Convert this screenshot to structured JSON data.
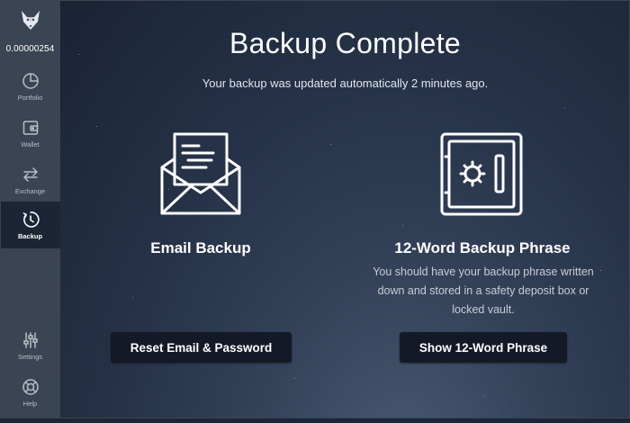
{
  "sidebar": {
    "logo": "fox-logo-icon",
    "balance": "0.00000254",
    "items": [
      {
        "label": "Portfolio",
        "icon": "pie-chart-icon"
      },
      {
        "label": "Wallet",
        "icon": "wallet-icon"
      },
      {
        "label": "Exchange",
        "icon": "exchange-arrows-icon"
      },
      {
        "label": "Backup",
        "icon": "backup-clock-icon",
        "active": true
      },
      {
        "label": "Settings",
        "icon": "sliders-icon"
      },
      {
        "label": "Help",
        "icon": "lifebuoy-icon"
      }
    ]
  },
  "main": {
    "title": "Backup Complete",
    "subtitle": "Your backup was updated automatically 2 minutes ago.",
    "email_card": {
      "title": "Email Backup",
      "icon": "envelope-letter-icon",
      "button": "Reset Email & Password"
    },
    "phrase_card": {
      "title": "12-Word Backup Phrase",
      "icon": "safe-vault-icon",
      "description": "You should have your backup phrase written down and stored in a safety deposit box or locked vault.",
      "button": "Show 12-Word Phrase"
    }
  },
  "colors": {
    "sidebar_bg": "#3a4452",
    "active_bg": "#1c2535",
    "button_bg": "#131a26"
  }
}
